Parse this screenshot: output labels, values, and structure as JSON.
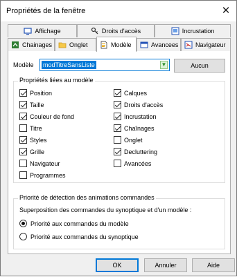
{
  "window": {
    "title": "Propriétés de la fenêtre",
    "close_glyph": "✕"
  },
  "tabs_back": [
    {
      "label": "Affichage",
      "icon": "monitor-icon"
    },
    {
      "label": "Droits d'accès",
      "icon": "key-icon"
    },
    {
      "label": "Incrustation",
      "icon": "layers-icon"
    }
  ],
  "tabs_front": [
    {
      "label": "Chainages",
      "icon": "chain-icon"
    },
    {
      "label": "Onglet",
      "icon": "folder-icon"
    },
    {
      "label": "Modèle",
      "icon": "document-icon",
      "active": true
    },
    {
      "label": "Avancees",
      "icon": "window-icon"
    },
    {
      "label": "Navigateur",
      "icon": "navigator-icon"
    }
  ],
  "model": {
    "label": "Modèle",
    "value": "modTitreSansListe",
    "none_button": "Aucun"
  },
  "properties": {
    "title": "Propriétés liées au modèle",
    "left": [
      {
        "label": "Position",
        "checked": true
      },
      {
        "label": "Taille",
        "checked": true
      },
      {
        "label": "Couleur de fond",
        "checked": true
      },
      {
        "label": "Titre",
        "checked": false
      },
      {
        "label": "Styles",
        "checked": true
      },
      {
        "label": "Grille",
        "checked": true
      },
      {
        "label": "Navigateur",
        "checked": false
      },
      {
        "label": "Programmes",
        "checked": false
      }
    ],
    "right": [
      {
        "label": "Calques",
        "checked": true
      },
      {
        "label": "Droits d'accès",
        "checked": true
      },
      {
        "label": "Incrustation",
        "checked": true
      },
      {
        "label": "Chaînages",
        "checked": true
      },
      {
        "label": "Onglet",
        "checked": false
      },
      {
        "label": "Decluttering",
        "checked": true
      },
      {
        "label": "Avancées",
        "checked": false
      }
    ]
  },
  "priority": {
    "title": "Priorité de détection des animations commandes",
    "description": "Superposition des commandes du synoptique et d'un modèle :",
    "options": [
      {
        "label": "Priorité aux commandes du modèle",
        "selected": true
      },
      {
        "label": "Priorité aux commandes du synoptique",
        "selected": false
      }
    ]
  },
  "buttons": {
    "ok": "OK",
    "cancel": "Annuler",
    "help": "Aide"
  }
}
